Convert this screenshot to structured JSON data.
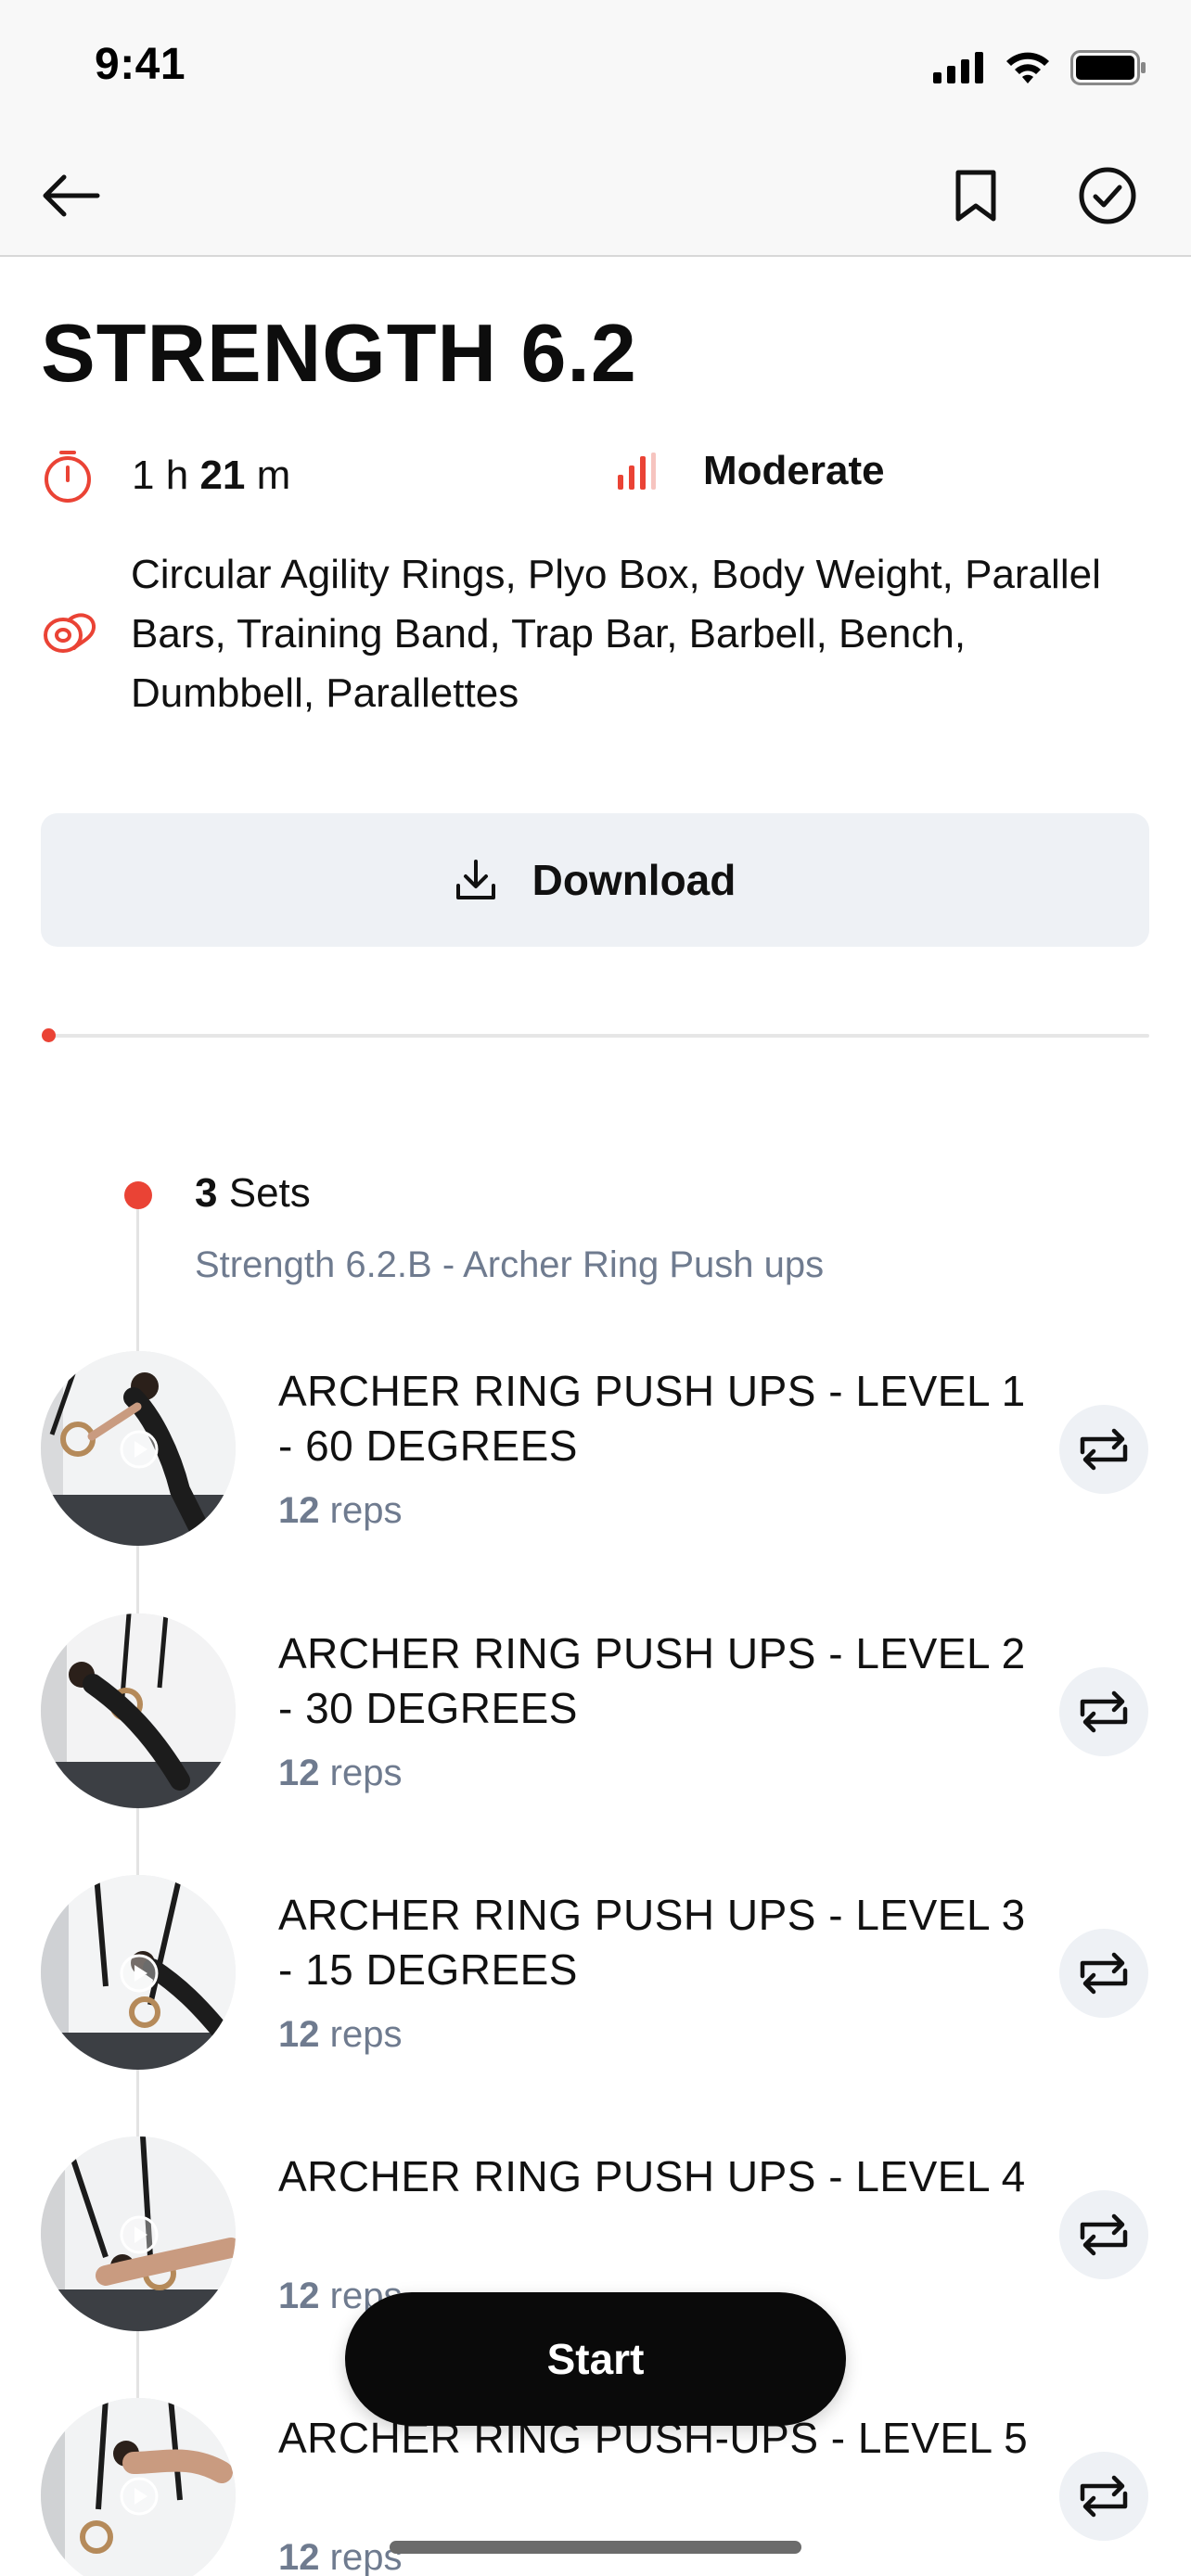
{
  "status_bar": {
    "time": "9:41"
  },
  "nav": {
    "back_icon": "arrow-left-icon",
    "bookmark_icon": "bookmark-icon",
    "complete_icon": "check-circle-icon"
  },
  "workout": {
    "title": "STRENGTH 6.2",
    "duration": {
      "hours": "1",
      "h_unit": "h",
      "minutes": "21",
      "m_unit": "m"
    },
    "difficulty": "Moderate",
    "equipment": "Circular Agility Rings, Plyo Box, Body Weight, Parallel Bars, Training Band, Trap Bar, Barbell, Bench, Dumbbell, Parallettes"
  },
  "download": {
    "label": "Download",
    "icon": "download-icon"
  },
  "progress": {
    "fraction": 0.0
  },
  "section": {
    "sets_count": "3",
    "sets_label": "Sets",
    "subtitle": "Strength 6.2.B - Archer Ring Push ups"
  },
  "exercises": [
    {
      "name": "ARCHER RING PUSH UPS - LEVEL 1 - 60 DEGREES",
      "reps_count": "12",
      "reps_label": "reps"
    },
    {
      "name": "ARCHER RING PUSH UPS - LEVEL 2 - 30 DEGREES",
      "reps_count": "12",
      "reps_label": "reps"
    },
    {
      "name": "ARCHER RING PUSH UPS - LEVEL 3 - 15 DEGREES",
      "reps_count": "12",
      "reps_label": "reps"
    },
    {
      "name": "ARCHER RING PUSH UPS - LEVEL 4",
      "reps_count": "12",
      "reps_label": "reps"
    },
    {
      "name": "ARCHER RING PUSH-UPS - LEVEL 5",
      "reps_count": "12",
      "reps_label": "reps"
    }
  ],
  "start_button": {
    "label": "Start"
  },
  "colors": {
    "accent": "#ea4335",
    "muted_text": "#6f7b8f",
    "button_bg": "#eef1f5"
  }
}
